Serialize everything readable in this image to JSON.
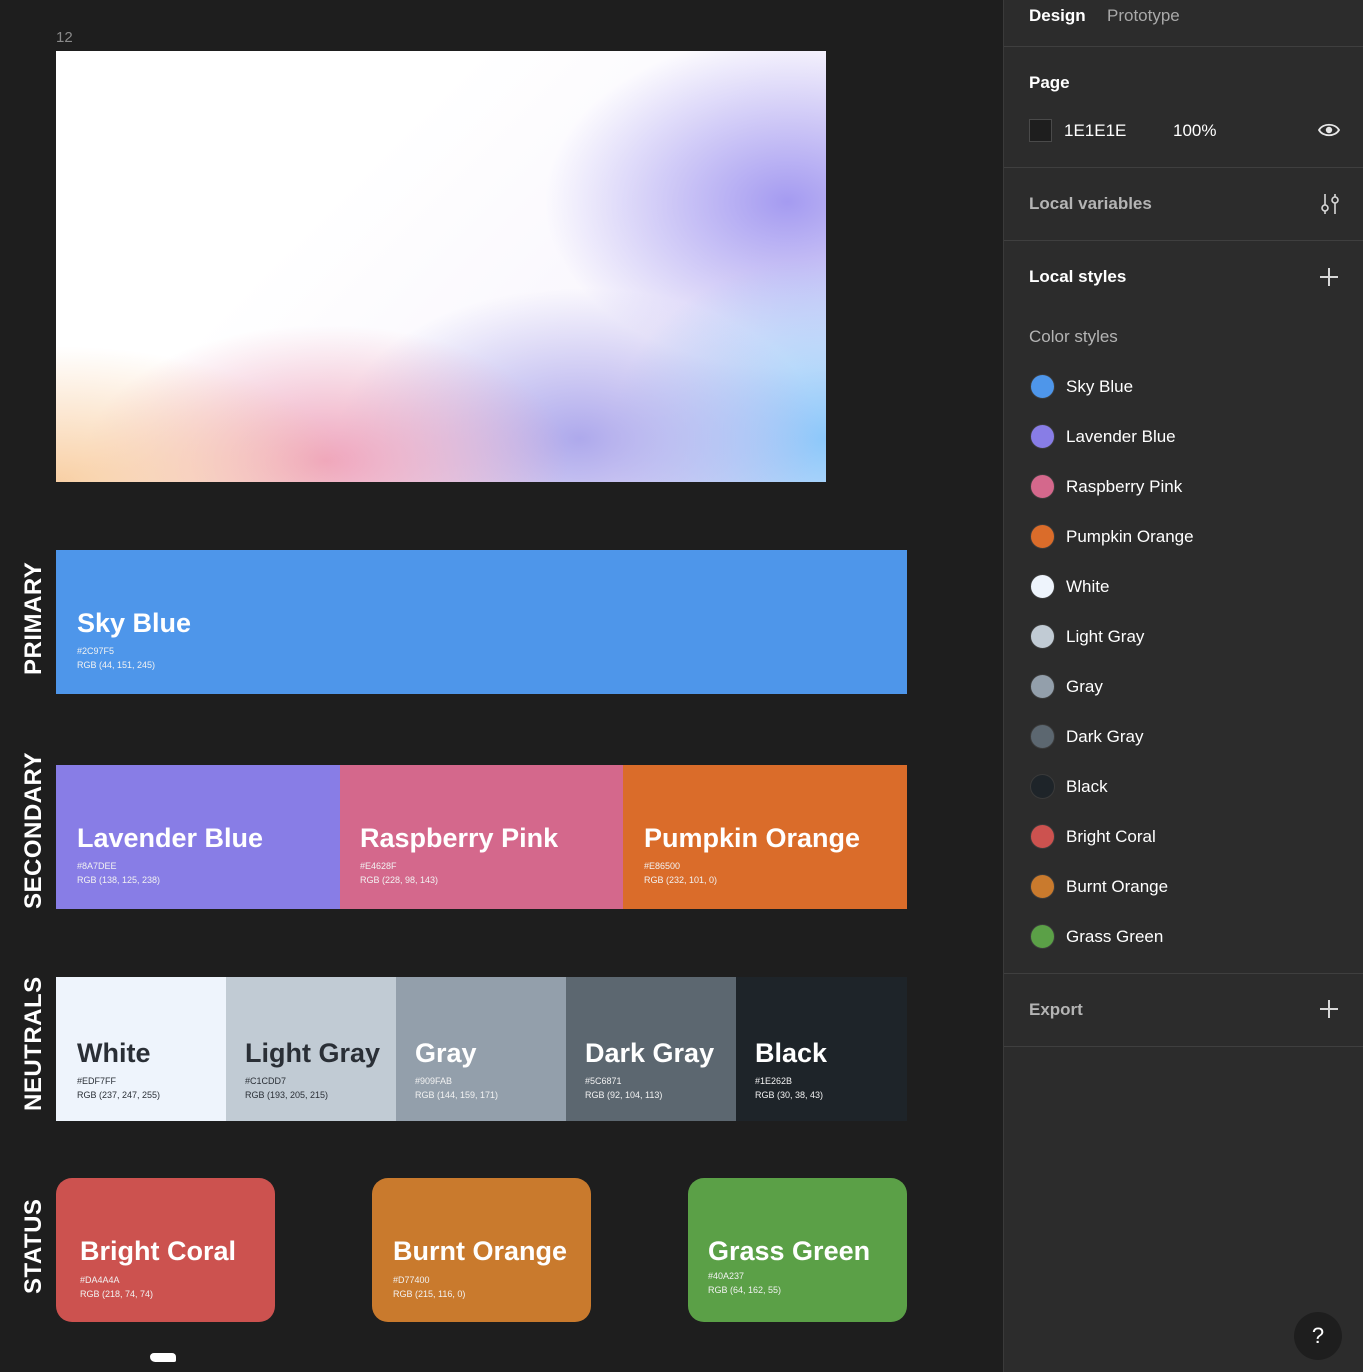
{
  "canvas": {
    "frame_label": "12",
    "sections": {
      "primary": "PRIMARY",
      "secondary": "SECONDARY",
      "neutrals": "NEUTRALS",
      "status": "STATUS"
    },
    "swatches": {
      "primary": [
        {
          "name": "Sky Blue",
          "hex": "#2C97F5",
          "rgb": "RGB (44, 151, 245)",
          "color": "#4e96ea"
        }
      ],
      "secondary": [
        {
          "name": "Lavender Blue",
          "hex": "#8A7DEE",
          "rgb": "RGB (138, 125, 238)",
          "color": "#887de6"
        },
        {
          "name": "Raspberry Pink",
          "hex": "#E4628F",
          "rgb": "RGB (228, 98, 143)",
          "color": "#d4688c"
        },
        {
          "name": "Pumpkin Orange",
          "hex": "#E86500",
          "rgb": "RGB (232, 101, 0)",
          "color": "#da6c2a"
        }
      ],
      "neutrals": [
        {
          "name": "White",
          "hex": "#EDF7FF",
          "rgb": "RGB (237, 247, 255)",
          "color": "#eef4fc"
        },
        {
          "name": "Light Gray",
          "hex": "#C1CDD7",
          "rgb": "RGB (193, 205, 215)",
          "color": "#c1cbd4"
        },
        {
          "name": "Gray",
          "hex": "#909FAB",
          "rgb": "RGB (144, 159, 171)",
          "color": "#939fab"
        },
        {
          "name": "Dark Gray",
          "hex": "#5C6871",
          "rgb": "RGB (92, 104, 113)",
          "color": "#5c6770"
        },
        {
          "name": "Black",
          "hex": "#1E262B",
          "rgb": "RGB (30, 38, 43)",
          "color": "#1e2429"
        }
      ],
      "status": [
        {
          "name": "Bright Coral",
          "hex": "#DA4A4A",
          "rgb": "RGB (218, 74, 74)",
          "color": "#cc524f"
        },
        {
          "name": "Burnt Orange",
          "hex": "#D77400",
          "rgb": "RGB (215, 116, 0)",
          "color": "#c97a2d"
        },
        {
          "name": "Grass Green",
          "hex": "#40A237",
          "rgb": "RGB (64, 162, 55)",
          "color": "#5ba047"
        }
      ]
    }
  },
  "panel": {
    "tabs": {
      "design": "Design",
      "prototype": "Prototype"
    },
    "page": {
      "title": "Page",
      "color_value": "1E1E1E",
      "opacity": "100%",
      "swatch_color": "#1e1e1e"
    },
    "local_variables": "Local variables",
    "local_styles": "Local styles",
    "color_styles_heading": "Color styles",
    "color_styles": [
      {
        "label": "Sky Blue",
        "color": "#4e96ea"
      },
      {
        "label": "Lavender Blue",
        "color": "#887de6"
      },
      {
        "label": "Raspberry Pink",
        "color": "#d4688c"
      },
      {
        "label": "Pumpkin Orange",
        "color": "#da6c2a"
      },
      {
        "label": "White",
        "color": "#eef4fc"
      },
      {
        "label": "Light Gray",
        "color": "#c1cbd4"
      },
      {
        "label": "Gray",
        "color": "#939fab"
      },
      {
        "label": "Dark Gray",
        "color": "#5c6770"
      },
      {
        "label": "Black",
        "color": "#1e2429"
      },
      {
        "label": "Bright Coral",
        "color": "#cc524f"
      },
      {
        "label": "Burnt Orange",
        "color": "#c97a2d"
      },
      {
        "label": "Grass Green",
        "color": "#5ba047"
      }
    ],
    "export": "Export",
    "help": "?"
  }
}
